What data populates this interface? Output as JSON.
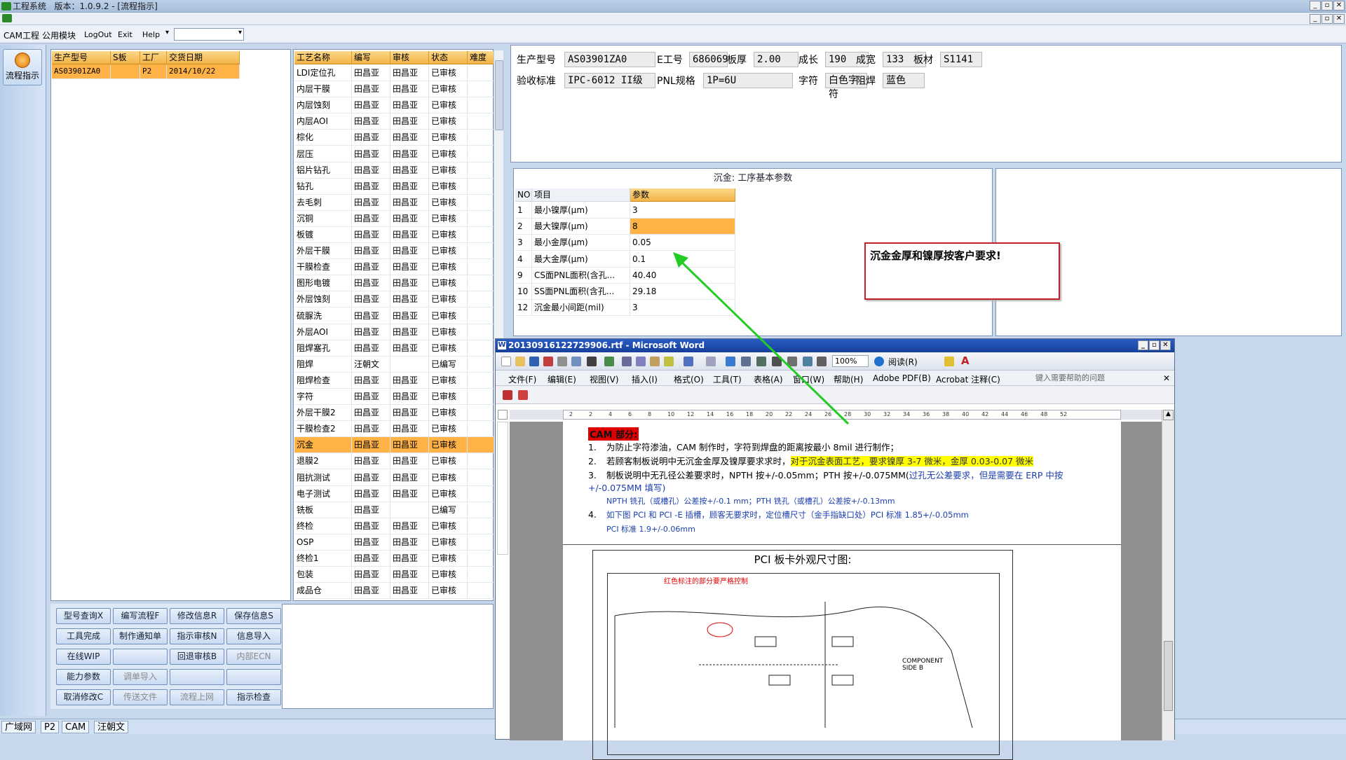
{
  "app": {
    "title": "工程系统",
    "version": "版本：1.0.9.2 - [流程指示]"
  },
  "menu": [
    "CAM工程",
    "公用模块",
    "LogOut",
    "Exit",
    "Help"
  ],
  "nav": {
    "label": "流程指示"
  },
  "product_grid": {
    "headers": [
      "生产型号",
      "S板",
      "工厂",
      "交货日期"
    ],
    "rows": [
      [
        "AS03901ZA0",
        "",
        "P2",
        "2014/10/22"
      ]
    ]
  },
  "process_grid": {
    "headers": [
      "工艺名称",
      "编写",
      "审核",
      "状态",
      "难度"
    ],
    "rows": [
      [
        "LDI定位孔",
        "田昌亚",
        "田昌亚",
        "已审核",
        ""
      ],
      [
        "内层干膜",
        "田昌亚",
        "田昌亚",
        "已审核",
        ""
      ],
      [
        "内层蚀刻",
        "田昌亚",
        "田昌亚",
        "已审核",
        ""
      ],
      [
        "内层AOI",
        "田昌亚",
        "田昌亚",
        "已审核",
        ""
      ],
      [
        "棕化",
        "田昌亚",
        "田昌亚",
        "已审核",
        ""
      ],
      [
        "层压",
        "田昌亚",
        "田昌亚",
        "已审核",
        ""
      ],
      [
        "铝片钻孔",
        "田昌亚",
        "田昌亚",
        "已审核",
        ""
      ],
      [
        "钻孔",
        "田昌亚",
        "田昌亚",
        "已审核",
        ""
      ],
      [
        "去毛刺",
        "田昌亚",
        "田昌亚",
        "已审核",
        ""
      ],
      [
        "沉铜",
        "田昌亚",
        "田昌亚",
        "已审核",
        ""
      ],
      [
        "板镀",
        "田昌亚",
        "田昌亚",
        "已审核",
        ""
      ],
      [
        "外层干膜",
        "田昌亚",
        "田昌亚",
        "已审核",
        ""
      ],
      [
        "干膜检查",
        "田昌亚",
        "田昌亚",
        "已审核",
        ""
      ],
      [
        "图形电镀",
        "田昌亚",
        "田昌亚",
        "已审核",
        ""
      ],
      [
        "外层蚀刻",
        "田昌亚",
        "田昌亚",
        "已审核",
        ""
      ],
      [
        "硫脲洗",
        "田昌亚",
        "田昌亚",
        "已审核",
        ""
      ],
      [
        "外层AOI",
        "田昌亚",
        "田昌亚",
        "已审核",
        ""
      ],
      [
        "阻焊塞孔",
        "田昌亚",
        "田昌亚",
        "已审核",
        ""
      ],
      [
        "阻焊",
        "汪朝文",
        "",
        "已编写",
        ""
      ],
      [
        "阻焊检查",
        "田昌亚",
        "田昌亚",
        "已审核",
        ""
      ],
      [
        "字符",
        "田昌亚",
        "田昌亚",
        "已审核",
        ""
      ],
      [
        "外层干膜2",
        "田昌亚",
        "田昌亚",
        "已审核",
        ""
      ],
      [
        "干膜检查2",
        "田昌亚",
        "田昌亚",
        "已审核",
        ""
      ],
      [
        "沉金",
        "田昌亚",
        "田昌亚",
        "已审核",
        ""
      ],
      [
        "退膜2",
        "田昌亚",
        "田昌亚",
        "已审核",
        ""
      ],
      [
        "阻抗测试",
        "田昌亚",
        "田昌亚",
        "已审核",
        ""
      ],
      [
        "电子测试",
        "田昌亚",
        "田昌亚",
        "已审核",
        ""
      ],
      [
        "铣板",
        "田昌亚",
        "",
        "已编写",
        ""
      ],
      [
        "终检",
        "田昌亚",
        "田昌亚",
        "已审核",
        ""
      ],
      [
        "OSP",
        "田昌亚",
        "田昌亚",
        "已审核",
        ""
      ],
      [
        "终检1",
        "田昌亚",
        "田昌亚",
        "已审核",
        ""
      ],
      [
        "包装",
        "田昌亚",
        "田昌亚",
        "已审核",
        ""
      ],
      [
        "成品仓",
        "田昌亚",
        "田昌亚",
        "已审核",
        ""
      ]
    ],
    "selected_index": 23
  },
  "buttons": [
    [
      "型号查询X",
      "编写流程F",
      "修改信息R",
      "保存信息S"
    ],
    [
      "工具完成",
      "制作通知单",
      "指示审核N",
      "信息导入"
    ],
    [
      "在线WIP",
      "",
      "回退审核B",
      "内部ECN"
    ],
    [
      "能力参数",
      "调单导入",
      "",
      ""
    ],
    [
      "取消修改C",
      "传送文件",
      "流程上网",
      "指示检查"
    ]
  ],
  "disabled_buttons": [
    "内部ECN",
    "调单导入",
    "传送文件",
    "流程上网"
  ],
  "info": {
    "row1": [
      [
        "生产型号",
        "AS03901ZA0"
      ],
      [
        "E工号",
        "686069"
      ],
      [
        "板厚",
        "2.00"
      ],
      [
        "成长",
        "190"
      ],
      [
        "成宽",
        "133"
      ],
      [
        "板材",
        "S1141"
      ]
    ],
    "row2": [
      [
        "验收标准",
        "IPC-6012 II级"
      ],
      [
        "PNL规格",
        "1P=6U"
      ],
      [
        "字符",
        "白色字符"
      ],
      [
        "阻焊",
        "蓝色"
      ]
    ]
  },
  "param_panel": {
    "title": "沉金: 工序基本参数",
    "headers": [
      "NO",
      "项目",
      "参数"
    ],
    "rows": [
      [
        "1",
        "最小镍厚(μm)",
        "3"
      ],
      [
        "2",
        "最大镍厚(μm)",
        "8"
      ],
      [
        "3",
        "最小金厚(μm)",
        "0.05"
      ],
      [
        "4",
        "最大金厚(μm)",
        "0.1"
      ],
      [
        "9",
        "CS面PNL面积(含孔...",
        "40.40"
      ],
      [
        "10",
        "SS面PNL面积(含孔...",
        "29.18"
      ],
      [
        "12",
        "沉金最小间距(mil)",
        "3"
      ]
    ],
    "highlight_index": 1
  },
  "callout": {
    "text": "沉金金厚和镍厚按客户要求!"
  },
  "status": [
    "广域网",
    "P2",
    "CAM",
    "汪朝文"
  ],
  "word": {
    "title": "20130916122729906.rtf - Microsoft Word",
    "menu": [
      "文件(F)",
      "编辑(E)",
      "视图(V)",
      "插入(I)",
      "格式(O)",
      "工具(T)",
      "表格(A)",
      "窗口(W)",
      "帮助(H)",
      "Adobe PDF(B)",
      "Acrobat 注释(C)"
    ],
    "help_placeholder": "键入需要帮助的问题",
    "zoom": "100%",
    "read": "阅读(R)",
    "heading": "CAM 部分:",
    "items": [
      {
        "n": "1.",
        "t": "为防止字符渗油，CAM 制作时，字符到焊盘的距离按最小 8mil 进行制作；"
      },
      {
        "n": "2.",
        "t": "若顾客制板说明中无沉金金厚及镍厚要求求时，",
        "hl": "对于沉金表面工艺，要求镍厚 3-7 微米，金厚 0.03-0.07 微米"
      },
      {
        "n": "3.",
        "t": "制板说明中无孔径公差要求时，NPTH 按+/-0.05mm；PTH 按+/-0.075MM(",
        "blue": "过孔无公差要求，但是需要在 ERP 中按 +/-0.075MM 填写)"
      },
      {
        "n": "",
        "sub": "NPTH 铣孔（或槽孔）公差按+/-0.1 mm；PTH 铣孔（或槽孔）公差按+/-0.13mm"
      },
      {
        "n": "4.",
        "blue2": "如下图 PCI 和 PCI -E 插槽，顾客无要求时，定位槽尺寸（金手指缺口处）PCI 标准 1.85+/-0.05mm"
      },
      {
        "n": "",
        "sub": "PCI 标准 1.9+/-0.06mm"
      }
    ],
    "figure_title": "PCI 板卡外观尺寸图:",
    "figure_note": "红色标注的部分要严格控制",
    "figure_side": "COMPONENT SIDE B",
    "ruler": [
      "2",
      "2",
      "4",
      "6",
      "8",
      "10",
      "12",
      "14",
      "16",
      "18",
      "20",
      "22",
      "24",
      "26",
      "28",
      "30",
      "32",
      "34",
      "36",
      "38",
      "40",
      "42",
      "44",
      "46",
      "48",
      "52"
    ]
  },
  "colors": {
    "grid_header": "#f3b449",
    "selected_row": "#f2b140",
    "callout_border": "#c0202a",
    "arrow": "#22cc22",
    "highlight_text_bg": "#ffff00"
  }
}
